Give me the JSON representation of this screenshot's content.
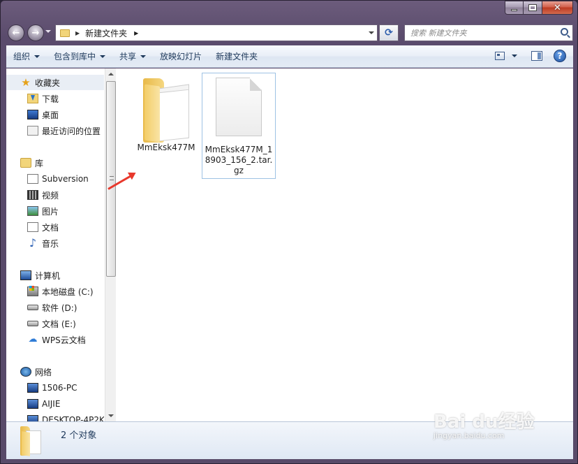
{
  "window": {
    "address_path": "新建文件夹",
    "search_placeholder": "搜索 新建文件夹"
  },
  "toolbar": {
    "organize": "组织",
    "include_in_library": "包含到库中",
    "share": "共享",
    "slideshow": "放映幻灯片",
    "new_folder": "新建文件夹"
  },
  "nav": {
    "favorites": {
      "label": "收藏夹",
      "items": [
        "下载",
        "桌面",
        "最近访问的位置"
      ]
    },
    "libraries": {
      "label": "库",
      "items": [
        "Subversion",
        "视频",
        "图片",
        "文档",
        "音乐"
      ]
    },
    "computer": {
      "label": "计算机",
      "items": [
        "本地磁盘 (C:)",
        "软件 (D:)",
        "文档 (E:)",
        "WPS云文档"
      ]
    },
    "network": {
      "label": "网络",
      "items": [
        "1506-PC",
        "AIJIE",
        "DESKTOP-4P2K"
      ]
    }
  },
  "files": [
    {
      "name": "MmEksk477M",
      "type": "folder"
    },
    {
      "name": "MmEksk477M_18903_156_2.tar.gz",
      "type": "file"
    }
  ],
  "details": {
    "count_text": "2 个对象"
  },
  "watermark": {
    "logo": "Bai  du经验",
    "url": "jingyan.baidu.com"
  },
  "colors": {
    "arrow": "#e8382c",
    "toolbar_text": "#1e395b",
    "hover_border": "#9ec2e4"
  }
}
